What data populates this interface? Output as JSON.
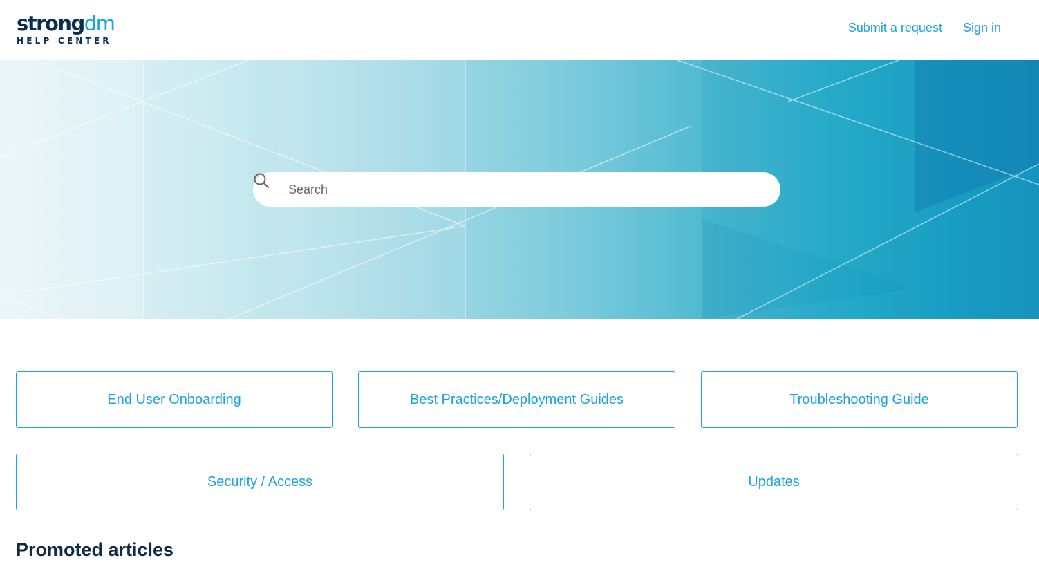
{
  "brand": {
    "logo_main": "strong",
    "logo_accent": "dm",
    "logo_sub": "HELP CENTER"
  },
  "nav": {
    "submit_request": "Submit a request",
    "sign_in": "Sign in"
  },
  "search": {
    "placeholder": "Search"
  },
  "categories": [
    {
      "label": "End User Onboarding"
    },
    {
      "label": "Best Practices/Deployment Guides"
    },
    {
      "label": "Troubleshooting Guide"
    },
    {
      "label": "Security / Access"
    },
    {
      "label": "Updates"
    }
  ],
  "sections": {
    "promoted_title": "Promoted articles"
  },
  "colors": {
    "accent": "#1aa3e0",
    "brand_dark": "#0b2d4f"
  },
  "icons": {
    "search": "search-icon"
  }
}
